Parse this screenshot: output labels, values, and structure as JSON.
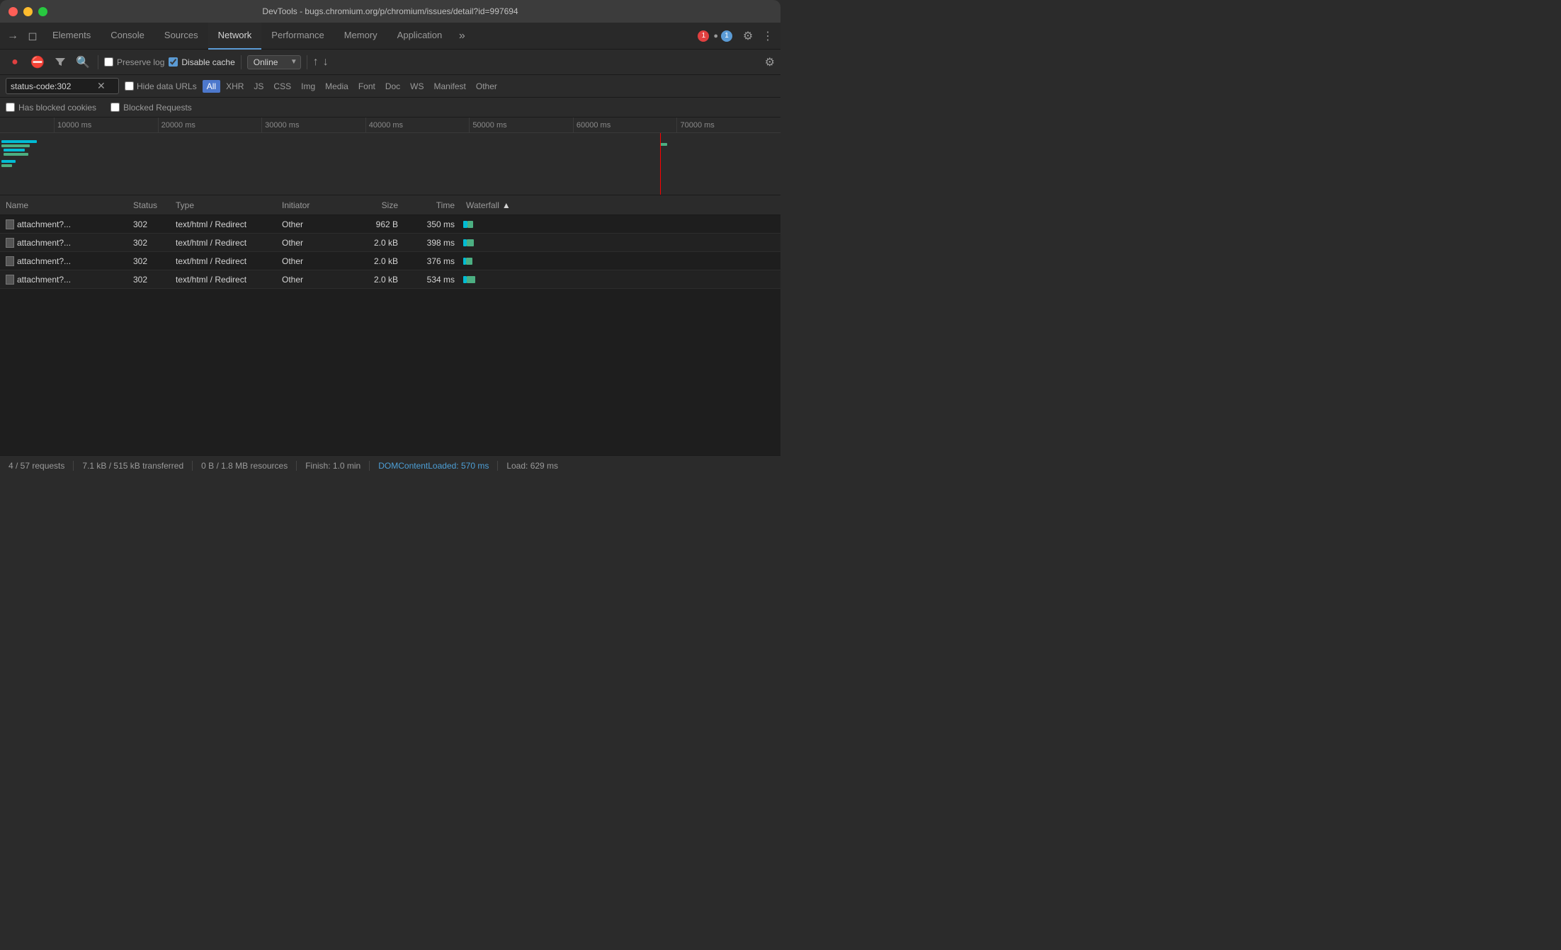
{
  "titleBar": {
    "title": "DevTools - bugs.chromium.org/p/chromium/issues/detail?id=997694"
  },
  "tabs": [
    {
      "label": "Elements",
      "active": false
    },
    {
      "label": "Console",
      "active": false
    },
    {
      "label": "Sources",
      "active": false
    },
    {
      "label": "Network",
      "active": true
    },
    {
      "label": "Performance",
      "active": false
    },
    {
      "label": "Memory",
      "active": false
    },
    {
      "label": "Application",
      "active": false
    }
  ],
  "badges": {
    "error_count": "1",
    "warning_count": "1"
  },
  "toolbar": {
    "preserve_log_label": "Preserve log",
    "disable_cache_label": "Disable cache",
    "online_label": "Online"
  },
  "filterBar": {
    "input_value": "status-code:302",
    "hide_data_urls_label": "Hide data URLs",
    "filter_types": [
      {
        "label": "All",
        "active": true
      },
      {
        "label": "XHR",
        "active": false
      },
      {
        "label": "JS",
        "active": false
      },
      {
        "label": "CSS",
        "active": false
      },
      {
        "label": "Img",
        "active": false
      },
      {
        "label": "Media",
        "active": false
      },
      {
        "label": "Font",
        "active": false
      },
      {
        "label": "Doc",
        "active": false
      },
      {
        "label": "WS",
        "active": false
      },
      {
        "label": "Manifest",
        "active": false
      },
      {
        "label": "Other",
        "active": false
      }
    ]
  },
  "checkboxRow": {
    "has_blocked_cookies": "Has blocked cookies",
    "blocked_requests": "Blocked Requests"
  },
  "timelineRuler": {
    "marks": [
      "10000 ms",
      "20000 ms",
      "30000 ms",
      "40000 ms",
      "50000 ms",
      "60000 ms",
      "70000 ms"
    ]
  },
  "tableHeaders": {
    "name": "Name",
    "status": "Status",
    "type": "Type",
    "initiator": "Initiator",
    "size": "Size",
    "time": "Time",
    "waterfall": "Waterfall"
  },
  "tableRows": [
    {
      "name": "attachment?...",
      "status": "302",
      "type": "text/html / Redirect",
      "initiator": "Other",
      "size": "962 B",
      "time": "350 ms"
    },
    {
      "name": "attachment?...",
      "status": "302",
      "type": "text/html / Redirect",
      "initiator": "Other",
      "size": "2.0 kB",
      "time": "398 ms"
    },
    {
      "name": "attachment?...",
      "status": "302",
      "type": "text/html / Redirect",
      "initiator": "Other",
      "size": "2.0 kB",
      "time": "376 ms"
    },
    {
      "name": "attachment?...",
      "status": "302",
      "type": "text/html / Redirect",
      "initiator": "Other",
      "size": "2.0 kB",
      "time": "534 ms"
    }
  ],
  "statusBar": {
    "requests": "4 / 57 requests",
    "transferred": "7.1 kB / 515 kB transferred",
    "resources": "0 B / 1.8 MB resources",
    "finish": "Finish: 1.0 min",
    "dom_content_loaded": "DOMContentLoaded: 570 ms",
    "load": "Load: 629 ms"
  }
}
